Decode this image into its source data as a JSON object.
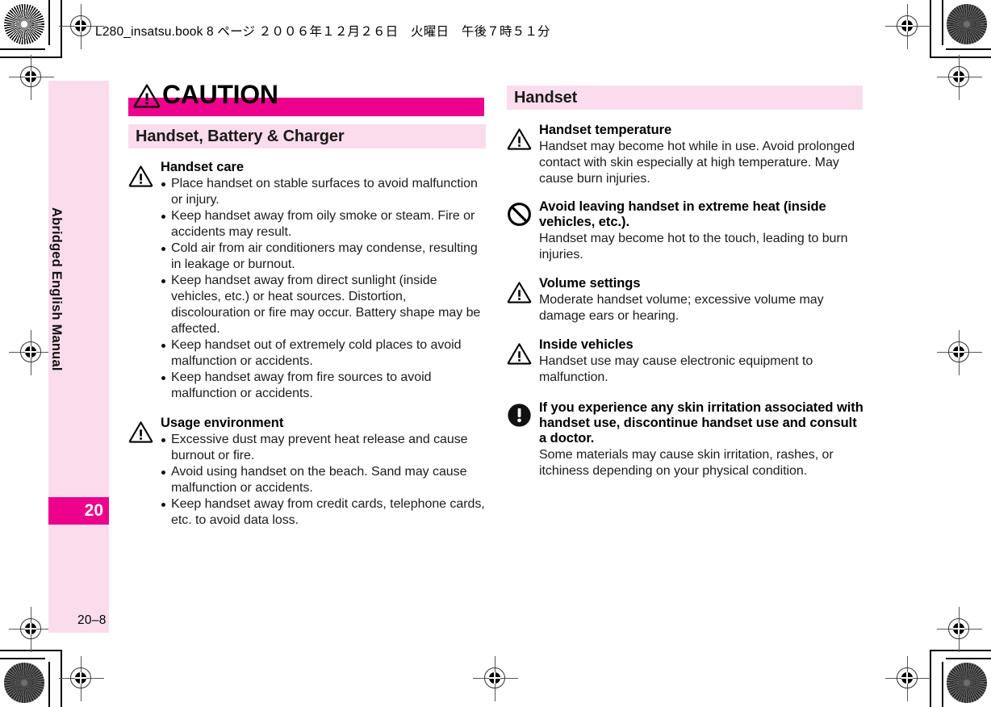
{
  "book_header": "L280_insatsu.book 8 ページ ２００６年１２月２６日　火曜日　午後７時５１分",
  "side_tab": {
    "label": "Abridged English Manual",
    "number": "20"
  },
  "folio": "20–8",
  "left_column": {
    "banner": {
      "icon": "warning-triangle-icon",
      "label": "CAUTION"
    },
    "section_header": "Handset, Battery & Charger",
    "entries": [
      {
        "icon": "warning-triangle-icon",
        "title": "Handset care",
        "bullets": [
          "Place handset on stable surfaces to avoid malfunction or injury.",
          "Keep handset away from oily smoke or steam. Fire or accidents may result.",
          "Cold air from air conditioners may condense, resulting in leakage or burnout.",
          "Keep handset away from direct sunlight (inside vehicles, etc.) or heat sources. Distortion, discolouration or fire may occur. Battery shape may be affected.",
          "Keep handset out of extremely cold places to avoid malfunction or accidents.",
          "Keep handset away from fire sources to avoid malfunction or accidents."
        ]
      },
      {
        "icon": "warning-triangle-icon",
        "title": "Usage environment",
        "bullets": [
          "Excessive dust may prevent heat release and cause burnout or fire.",
          "Avoid using handset on the beach. Sand may cause malfunction or accidents.",
          "Keep handset away from credit cards, telephone cards, etc. to avoid data loss."
        ]
      }
    ]
  },
  "right_column": {
    "section_header": "Handset",
    "entries": [
      {
        "icon": "warning-triangle-icon",
        "title": "Handset temperature",
        "desc": "Handset may become hot while in use. Avoid prolonged contact with skin especially at high temperature. May cause burn injuries."
      },
      {
        "icon": "prohibition-icon",
        "title": "Avoid leaving handset in extreme heat (inside vehicles, etc.).",
        "desc": "Handset may become hot to the touch, leading to burn injuries."
      },
      {
        "icon": "warning-triangle-icon",
        "title": "Volume settings",
        "desc": "Moderate handset volume; excessive volume may damage ears or hearing."
      },
      {
        "icon": "warning-triangle-icon",
        "title": "Inside vehicles",
        "desc": "Handset use may cause electronic equipment to malfunction."
      },
      {
        "icon": "mandatory-action-icon",
        "title": "If you experience any skin irritation associated with handset use, discontinue handset use and consult a doctor.",
        "desc": "Some materials may cause skin irritation, rashes, or itchiness depending on your physical condition."
      }
    ]
  },
  "colors": {
    "magenta": "#ec008c",
    "pink_tint": "#fadced",
    "text": "#1c1c1c"
  }
}
